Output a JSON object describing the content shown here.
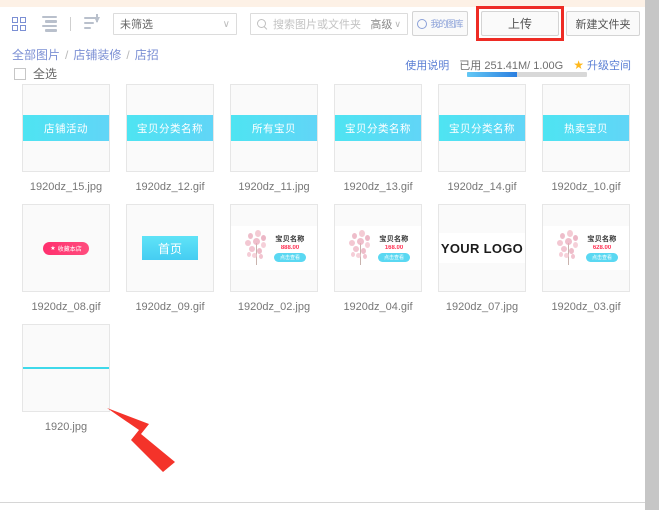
{
  "window": {
    "scrollbar": "vertical-scrollbar"
  },
  "toolbar": {
    "grid_view_icon": "grid-view-icon",
    "list_view_icon": "list-view-icon",
    "sort_icon": "sort-icon",
    "filter_select": {
      "value": "未筛选",
      "chevron": "∨"
    },
    "search": {
      "placeholder": "搜索图片或文件夹",
      "value": "",
      "advanced_label": "高级",
      "chevron": "∨"
    },
    "gallery_button": "我的图库",
    "upload_button": "上传",
    "new_folder_button": "新建文件夹",
    "highlight_color": "#ee2b24"
  },
  "breadcrumb": {
    "items": [
      "全部图片",
      "店铺装修",
      "店招"
    ],
    "separator": "/"
  },
  "select_all": {
    "label": "全选",
    "checked": false
  },
  "usage": {
    "help_label": "使用说明",
    "amount_label": "已用 251.41M/ 1.00G",
    "used": "251.41M",
    "total": "1.00G",
    "percent": 42,
    "upgrade_label": "升级空间",
    "star_icon": "★",
    "bar_fill_color": "#2b7fe0"
  },
  "grid": {
    "rows": [
      [
        {
          "filename": "1920dz_15.jpg",
          "kind": "band",
          "band_text": "店铺活动"
        },
        {
          "filename": "1920dz_12.gif",
          "kind": "band",
          "band_text": "宝贝分类名称"
        },
        {
          "filename": "1920dz_11.jpg",
          "kind": "band",
          "band_text": "所有宝贝"
        },
        {
          "filename": "1920dz_13.gif",
          "kind": "band",
          "band_text": "宝贝分类名称"
        },
        {
          "filename": "1920dz_14.gif",
          "kind": "band",
          "band_text": "宝贝分类名称"
        },
        {
          "filename": "1920dz_10.gif",
          "kind": "band",
          "band_text": "热卖宝贝"
        }
      ],
      [
        {
          "filename": "1920dz_08.gif",
          "kind": "pill",
          "pill_text": "收藏本店",
          "pill_icon": "★"
        },
        {
          "filename": "1920dz_09.gif",
          "kind": "homebtn",
          "button_text": "首页"
        },
        {
          "filename": "1920dz_02.jpg",
          "kind": "product",
          "product_name": "宝贝名称",
          "price": "888.00",
          "buy_label": "点击查看"
        },
        {
          "filename": "1920dz_04.gif",
          "kind": "product",
          "product_name": "宝贝名称",
          "price": "168.00",
          "buy_label": "点击查看"
        },
        {
          "filename": "1920dz_07.jpg",
          "kind": "logo",
          "logo_text": "YOUR LOGO"
        },
        {
          "filename": "1920dz_03.gif",
          "kind": "product",
          "product_name": "宝贝名称",
          "price": "628.00",
          "buy_label": "点击查看"
        }
      ],
      [
        {
          "filename": "1920.jpg",
          "kind": "line"
        }
      ]
    ]
  },
  "annotation": {
    "arrow_color": "#f4332a",
    "points_to": "1920.jpg"
  }
}
